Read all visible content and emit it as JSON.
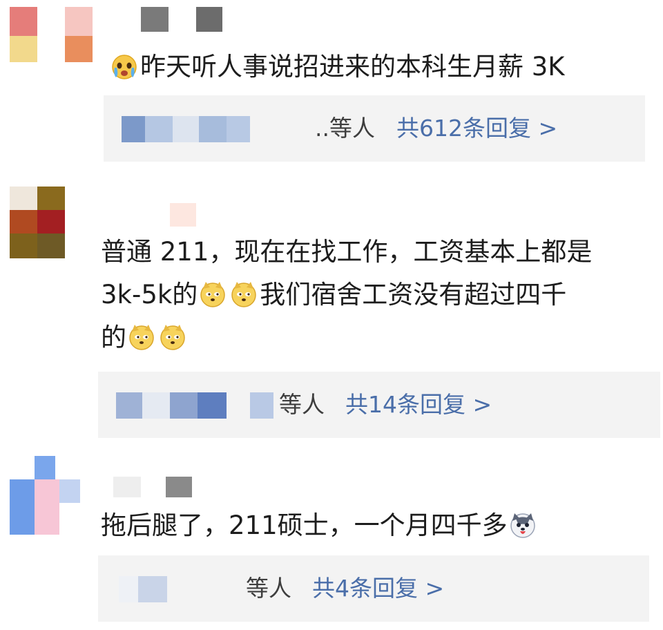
{
  "comments": [
    {
      "text": "昨天听人事说招进来的本科生月薪 3K",
      "emoji": "crying-face-icon",
      "reply_suffix": "..等人",
      "reply_count": "共612条回复 >"
    },
    {
      "line1": "普通 211，现在在找工作，工资基本上都是",
      "line2_a": "3k-5k的",
      "line2_b": "我们宿舍工资没有超过四千",
      "line3": "的",
      "emoji": "doge-icon",
      "reply_suffix": "等人",
      "reply_count": "共14条回复 >"
    },
    {
      "text": "拖后腿了，211硕士，一个月四千多",
      "emoji": "husky-icon",
      "reply_suffix": "等人",
      "reply_count": "共4条回复 >"
    }
  ],
  "colors": {
    "link": "#4a6ea9",
    "reply_bg": "#f3f3f3",
    "text": "#1d1d1d"
  }
}
